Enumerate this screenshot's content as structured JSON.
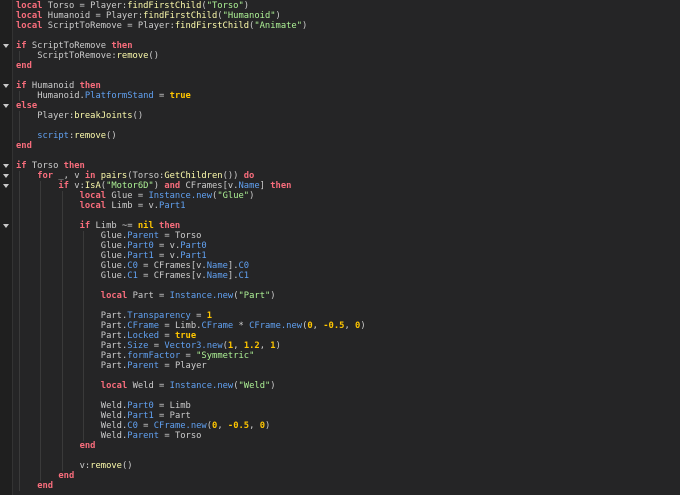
{
  "editor": {
    "indent_unit": 4,
    "lines": [
      {
        "i": 0,
        "tk": [
          [
            "k",
            "local"
          ],
          [
            "t",
            " Torso = Player:"
          ],
          [
            "f",
            "findFirstChild"
          ],
          [
            "t",
            "("
          ],
          [
            "s",
            "\"Torso\""
          ],
          [
            "t",
            ")"
          ]
        ]
      },
      {
        "i": 0,
        "tk": [
          [
            "k",
            "local"
          ],
          [
            "t",
            " Humanoid = Player:"
          ],
          [
            "f",
            "findFirstChild"
          ],
          [
            "t",
            "("
          ],
          [
            "s",
            "\"Humanoid\""
          ],
          [
            "t",
            ")"
          ]
        ]
      },
      {
        "i": 0,
        "tk": [
          [
            "k",
            "local"
          ],
          [
            "t",
            " ScriptToRemove = Player:"
          ],
          [
            "f",
            "findFirstChild"
          ],
          [
            "t",
            "("
          ],
          [
            "s",
            "\"Animate\""
          ],
          [
            "t",
            ")"
          ]
        ]
      },
      {
        "i": 0,
        "tk": []
      },
      {
        "i": 0,
        "fold": true,
        "tk": [
          [
            "k",
            "if"
          ],
          [
            "t",
            " ScriptToRemove "
          ],
          [
            "k",
            "then"
          ]
        ]
      },
      {
        "i": 1,
        "tk": [
          [
            "t",
            "ScriptToRemove:"
          ],
          [
            "f",
            "remove"
          ],
          [
            "t",
            "()"
          ]
        ]
      },
      {
        "i": 0,
        "tk": [
          [
            "k",
            "end"
          ]
        ]
      },
      {
        "i": 0,
        "tk": []
      },
      {
        "i": 0,
        "fold": true,
        "tk": [
          [
            "k",
            "if"
          ],
          [
            "t",
            " Humanoid "
          ],
          [
            "k",
            "then"
          ]
        ]
      },
      {
        "i": 1,
        "tk": [
          [
            "t",
            "Humanoid."
          ],
          [
            "p",
            "PlatformStand"
          ],
          [
            "t",
            " = "
          ],
          [
            "n",
            "true"
          ]
        ]
      },
      {
        "i": 0,
        "fold": true,
        "tk": [
          [
            "k",
            "else"
          ]
        ]
      },
      {
        "i": 1,
        "tk": [
          [
            "t",
            "Player:"
          ],
          [
            "f",
            "breakJoints"
          ],
          [
            "t",
            "()"
          ]
        ]
      },
      {
        "i": 1,
        "tk": []
      },
      {
        "i": 1,
        "tk": [
          [
            "p",
            "script"
          ],
          [
            "t",
            ":"
          ],
          [
            "f",
            "remove"
          ],
          [
            "t",
            "()"
          ]
        ]
      },
      {
        "i": 0,
        "tk": [
          [
            "k",
            "end"
          ]
        ]
      },
      {
        "i": 0,
        "tk": []
      },
      {
        "i": 0,
        "fold": true,
        "tk": [
          [
            "k",
            "if"
          ],
          [
            "t",
            " Torso "
          ],
          [
            "k",
            "then"
          ]
        ]
      },
      {
        "i": 1,
        "fold": true,
        "tk": [
          [
            "k",
            "for"
          ],
          [
            "t",
            " _, v "
          ],
          [
            "k",
            "in"
          ],
          [
            "t",
            " "
          ],
          [
            "f",
            "pairs"
          ],
          [
            "t",
            "(Torso:"
          ],
          [
            "f",
            "GetChildren"
          ],
          [
            "t",
            "()) "
          ],
          [
            "k",
            "do"
          ]
        ]
      },
      {
        "i": 2,
        "fold": true,
        "tk": [
          [
            "k",
            "if"
          ],
          [
            "t",
            " v:"
          ],
          [
            "f",
            "IsA"
          ],
          [
            "t",
            "("
          ],
          [
            "s",
            "\"Motor6D\""
          ],
          [
            "t",
            ") "
          ],
          [
            "k",
            "and"
          ],
          [
            "t",
            " CFrames[v."
          ],
          [
            "p",
            "Name"
          ],
          [
            "t",
            "] "
          ],
          [
            "k",
            "then"
          ]
        ]
      },
      {
        "i": 3,
        "tk": [
          [
            "k",
            "local"
          ],
          [
            "t",
            " Glue = "
          ],
          [
            "p",
            "Instance.new"
          ],
          [
            "t",
            "("
          ],
          [
            "s",
            "\"Glue\""
          ],
          [
            "t",
            ")"
          ]
        ]
      },
      {
        "i": 3,
        "tk": [
          [
            "k",
            "local"
          ],
          [
            "t",
            " Limb = v."
          ],
          [
            "p",
            "Part1"
          ]
        ]
      },
      {
        "i": 3,
        "tk": []
      },
      {
        "i": 3,
        "fold": true,
        "tk": [
          [
            "k",
            "if"
          ],
          [
            "t",
            " Limb ~= "
          ],
          [
            "n",
            "nil"
          ],
          [
            "t",
            " "
          ],
          [
            "k",
            "then"
          ]
        ]
      },
      {
        "i": 4,
        "tk": [
          [
            "t",
            "Glue."
          ],
          [
            "p",
            "Parent"
          ],
          [
            "t",
            " = Torso"
          ]
        ]
      },
      {
        "i": 4,
        "tk": [
          [
            "t",
            "Glue."
          ],
          [
            "p",
            "Part0"
          ],
          [
            "t",
            " = v."
          ],
          [
            "p",
            "Part0"
          ]
        ]
      },
      {
        "i": 4,
        "tk": [
          [
            "t",
            "Glue."
          ],
          [
            "p",
            "Part1"
          ],
          [
            "t",
            " = v."
          ],
          [
            "p",
            "Part1"
          ]
        ]
      },
      {
        "i": 4,
        "tk": [
          [
            "t",
            "Glue."
          ],
          [
            "p",
            "C0"
          ],
          [
            "t",
            " = CFrames[v."
          ],
          [
            "p",
            "Name"
          ],
          [
            "t",
            "]."
          ],
          [
            "p",
            "C0"
          ]
        ]
      },
      {
        "i": 4,
        "tk": [
          [
            "t",
            "Glue."
          ],
          [
            "p",
            "C1"
          ],
          [
            "t",
            " = CFrames[v."
          ],
          [
            "p",
            "Name"
          ],
          [
            "t",
            "]."
          ],
          [
            "p",
            "C1"
          ]
        ]
      },
      {
        "i": 4,
        "tk": []
      },
      {
        "i": 4,
        "tk": [
          [
            "k",
            "local"
          ],
          [
            "t",
            " Part = "
          ],
          [
            "p",
            "Instance.new"
          ],
          [
            "t",
            "("
          ],
          [
            "s",
            "\"Part\""
          ],
          [
            "t",
            ")"
          ]
        ]
      },
      {
        "i": 4,
        "tk": []
      },
      {
        "i": 4,
        "tk": [
          [
            "t",
            "Part."
          ],
          [
            "p",
            "Transparency"
          ],
          [
            "t",
            " = "
          ],
          [
            "n",
            "1"
          ]
        ]
      },
      {
        "i": 4,
        "tk": [
          [
            "t",
            "Part."
          ],
          [
            "p",
            "CFrame"
          ],
          [
            "t",
            " = Limb."
          ],
          [
            "p",
            "CFrame"
          ],
          [
            "t",
            " * "
          ],
          [
            "p",
            "CFrame.new"
          ],
          [
            "t",
            "("
          ],
          [
            "n",
            "0"
          ],
          [
            "t",
            ", "
          ],
          [
            "n",
            "-0.5"
          ],
          [
            "t",
            ", "
          ],
          [
            "n",
            "0"
          ],
          [
            "t",
            ")"
          ]
        ]
      },
      {
        "i": 4,
        "tk": [
          [
            "t",
            "Part."
          ],
          [
            "p",
            "Locked"
          ],
          [
            "t",
            " = "
          ],
          [
            "n",
            "true"
          ]
        ]
      },
      {
        "i": 4,
        "tk": [
          [
            "t",
            "Part."
          ],
          [
            "p",
            "Size"
          ],
          [
            "t",
            " = "
          ],
          [
            "p",
            "Vector3.new"
          ],
          [
            "t",
            "("
          ],
          [
            "n",
            "1"
          ],
          [
            "t",
            ", "
          ],
          [
            "n",
            "1.2"
          ],
          [
            "t",
            ", "
          ],
          [
            "n",
            "1"
          ],
          [
            "t",
            ")"
          ]
        ]
      },
      {
        "i": 4,
        "tk": [
          [
            "t",
            "Part."
          ],
          [
            "p",
            "formFactor"
          ],
          [
            "t",
            " = "
          ],
          [
            "s",
            "\"Symmetric\""
          ]
        ]
      },
      {
        "i": 4,
        "tk": [
          [
            "t",
            "Part."
          ],
          [
            "p",
            "Parent"
          ],
          [
            "t",
            " = Player"
          ]
        ]
      },
      {
        "i": 4,
        "tk": []
      },
      {
        "i": 4,
        "tk": [
          [
            "k",
            "local"
          ],
          [
            "t",
            " Weld = "
          ],
          [
            "p",
            "Instance.new"
          ],
          [
            "t",
            "("
          ],
          [
            "s",
            "\"Weld\""
          ],
          [
            "t",
            ")"
          ]
        ]
      },
      {
        "i": 4,
        "tk": []
      },
      {
        "i": 4,
        "tk": [
          [
            "t",
            "Weld."
          ],
          [
            "p",
            "Part0"
          ],
          [
            "t",
            " = Limb"
          ]
        ]
      },
      {
        "i": 4,
        "tk": [
          [
            "t",
            "Weld."
          ],
          [
            "p",
            "Part1"
          ],
          [
            "t",
            " = Part"
          ]
        ]
      },
      {
        "i": 4,
        "tk": [
          [
            "t",
            "Weld."
          ],
          [
            "p",
            "C0"
          ],
          [
            "t",
            " = "
          ],
          [
            "p",
            "CFrame.new"
          ],
          [
            "t",
            "("
          ],
          [
            "n",
            "0"
          ],
          [
            "t",
            ", "
          ],
          [
            "n",
            "-0.5"
          ],
          [
            "t",
            ", "
          ],
          [
            "n",
            "0"
          ],
          [
            "t",
            ")"
          ]
        ]
      },
      {
        "i": 4,
        "tk": [
          [
            "t",
            "Weld."
          ],
          [
            "p",
            "Parent"
          ],
          [
            "t",
            " = Torso"
          ]
        ]
      },
      {
        "i": 3,
        "tk": [
          [
            "k",
            "end"
          ]
        ]
      },
      {
        "i": 3,
        "tk": []
      },
      {
        "i": 3,
        "tk": [
          [
            "t",
            "v:"
          ],
          [
            "f",
            "remove"
          ],
          [
            "t",
            "()"
          ]
        ]
      },
      {
        "i": 2,
        "tk": [
          [
            "k",
            "end"
          ]
        ]
      },
      {
        "i": 1,
        "tk": [
          [
            "k",
            "end"
          ]
        ]
      }
    ]
  }
}
